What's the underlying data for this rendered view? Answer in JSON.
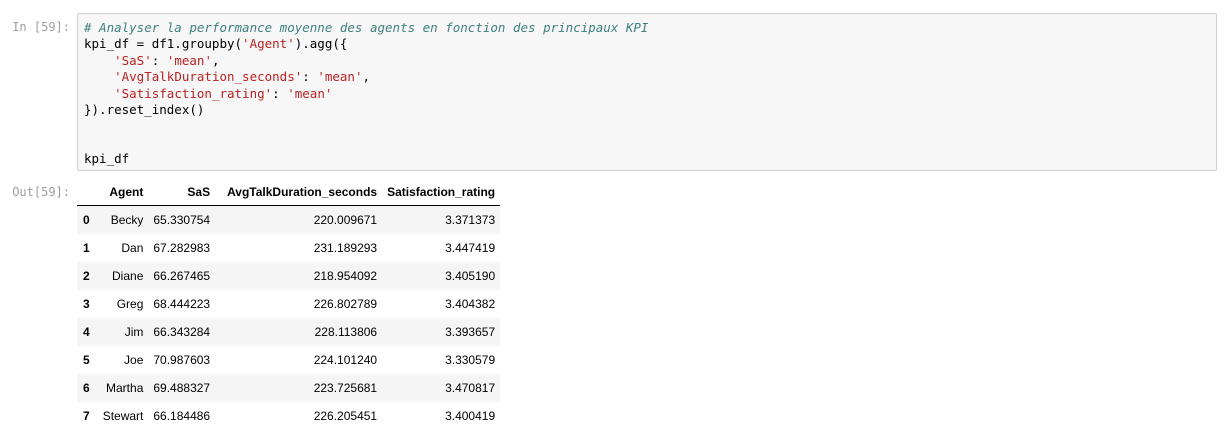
{
  "cells": {
    "input_prompt": "In [59]:",
    "output_prompt": "Out[59]:"
  },
  "code": {
    "comment": "# Analyser la performance moyenne des agents en fonction des principaux KPI",
    "line2_a": "kpi_df = df1.groupby(",
    "line2_str": "'Agent'",
    "line2_b": ").agg({",
    "line3_key": "'SaS'",
    "line3_sep": ": ",
    "line3_val": "'mean'",
    "line3_end": ",",
    "line4_key": "'AvgTalkDuration_seconds'",
    "line4_sep": ": ",
    "line4_val": "'mean'",
    "line4_end": ",",
    "line5_key": "'Satisfaction_rating'",
    "line5_sep": ": ",
    "line5_val": "'mean'",
    "line6": "}).reset_index()",
    "line9": "kpi_df"
  },
  "table": {
    "columns": [
      "",
      "Agent",
      "SaS",
      "AvgTalkDuration_seconds",
      "Satisfaction_rating"
    ],
    "rows": [
      {
        "index": "0",
        "agent": "Becky",
        "sas": "65.330754",
        "duration": "220.009671",
        "satisfaction": "3.371373"
      },
      {
        "index": "1",
        "agent": "Dan",
        "sas": "67.282983",
        "duration": "231.189293",
        "satisfaction": "3.447419"
      },
      {
        "index": "2",
        "agent": "Diane",
        "sas": "66.267465",
        "duration": "218.954092",
        "satisfaction": "3.405190"
      },
      {
        "index": "3",
        "agent": "Greg",
        "sas": "68.444223",
        "duration": "226.802789",
        "satisfaction": "3.404382"
      },
      {
        "index": "4",
        "agent": "Jim",
        "sas": "66.343284",
        "duration": "228.113806",
        "satisfaction": "3.393657"
      },
      {
        "index": "5",
        "agent": "Joe",
        "sas": "70.987603",
        "duration": "224.101240",
        "satisfaction": "3.330579"
      },
      {
        "index": "6",
        "agent": "Martha",
        "sas": "69.488327",
        "duration": "223.725681",
        "satisfaction": "3.470817"
      },
      {
        "index": "7",
        "agent": "Stewart",
        "sas": "66.184486",
        "duration": "226.205451",
        "satisfaction": "3.400419"
      }
    ]
  }
}
